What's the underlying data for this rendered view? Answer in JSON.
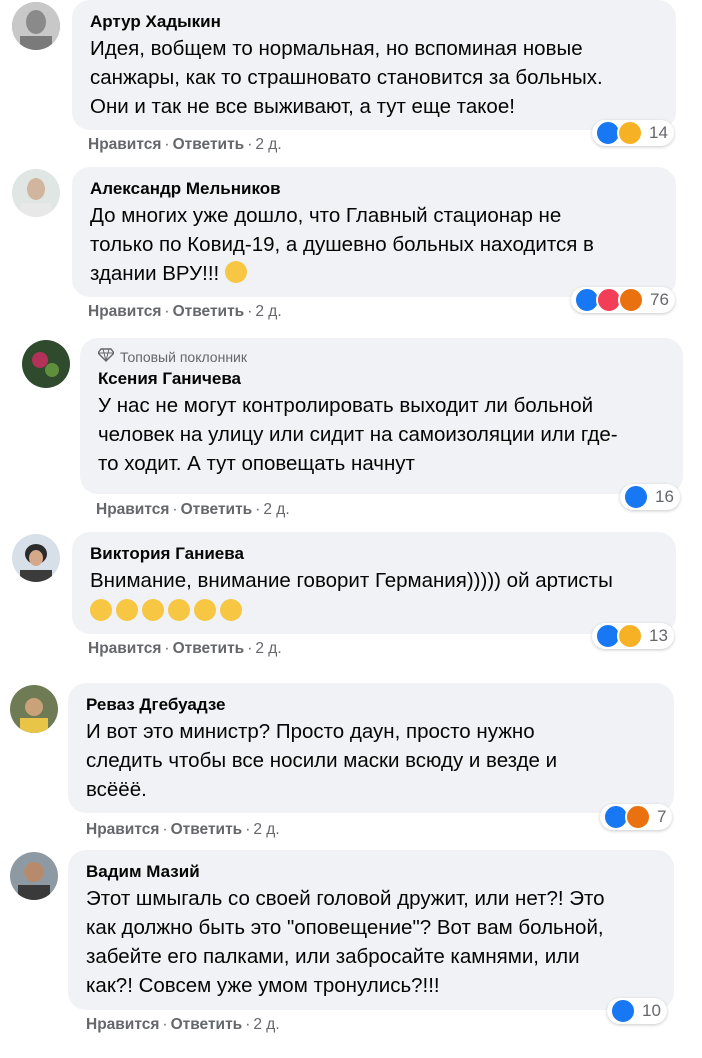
{
  "comments": [
    {
      "author": "Артур Хадыкин",
      "badge": "",
      "lines": [
        "Идея, вобщем то нормальная, но вспоминая новые",
        "санжары, как то страшновато становится за больных.",
        "Они и так не все выживают, а тут еще такое!"
      ],
      "reaction_icons": [
        "like-reaction-icon",
        "sad-reaction-icon"
      ],
      "reaction_count": "14",
      "like_label": "Нравится",
      "reply_label": "Ответить",
      "time": "2 д."
    },
    {
      "author": "Александр Мельников",
      "badge": "",
      "lines": [
        "До многих уже дошло, что Главный стационар не",
        "только по Ковид-19, а душевно больных находится в",
        "здании ВРУ!!! "
      ],
      "reaction_icons": [
        "like-reaction-icon",
        "love-reaction-icon",
        "angry-reaction-icon"
      ],
      "reaction_count": "76",
      "like_label": "Нравится",
      "reply_label": "Ответить",
      "time": "2 д."
    },
    {
      "author": "Ксения Ганичева",
      "badge": "Топовый поклонник",
      "lines": [
        "У нас не могут контролировать выходит ли больной",
        "человек на улицу или сидит на самоизоляции или где-",
        "то ходит. А тут оповещать начнут"
      ],
      "reaction_icons": [
        "like-reaction-icon"
      ],
      "reaction_count": "16",
      "like_label": "Нравится",
      "reply_label": "Ответить",
      "time": "2 д."
    },
    {
      "author": "Виктория Ганиева",
      "badge": "",
      "lines": [
        "Внимание, внимание говорит Германия))))) ой артисты"
      ],
      "reaction_icons": [
        "like-reaction-icon",
        "haha-reaction-icon"
      ],
      "reaction_count": "13",
      "like_label": "Нравится",
      "reply_label": "Ответить",
      "time": "2 д."
    },
    {
      "author": "Реваз Дгебуадзе",
      "badge": "",
      "lines": [
        "И вот это министр? Просто даун, просто нужно",
        "следить чтобы все носили маски всюду и везде и",
        "всёёё."
      ],
      "reaction_icons": [
        "like-reaction-icon",
        "angry-reaction-icon"
      ],
      "reaction_count": "7",
      "like_label": "Нравится",
      "reply_label": "Ответить",
      "time": "2 д."
    },
    {
      "author": "Вадим Мазий",
      "badge": "",
      "lines": [
        "Этот шмыгаль со своей головой дружит, или нет?! Это",
        "как должно быть это \"оповещение\"? Вот вам больной,",
        "забейте его палками, или забросайте камнями, или",
        "как?! Совсем уже умом тронулись?!!!"
      ],
      "reaction_icons": [
        "like-reaction-icon"
      ],
      "reaction_count": "10",
      "like_label": "Нравится",
      "reply_label": "Ответить",
      "time": "2 д."
    }
  ],
  "colors": {
    "bubble": "#f0f2f5",
    "secondary_text": "#65676b",
    "like_blue": "#1877f2"
  }
}
